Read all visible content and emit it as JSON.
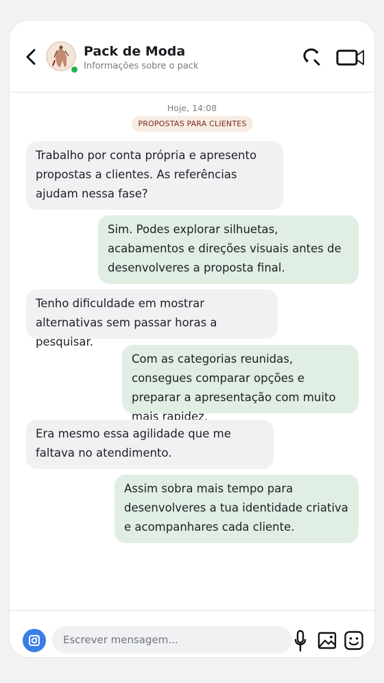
{
  "header": {
    "title": "Pack de Moda",
    "subtitle": "Informações sobre o pack",
    "icons": [
      "back-arrow-icon",
      "phone-icon",
      "video-camera-icon"
    ],
    "online_color": "#22b14c"
  },
  "thread": {
    "timestamp": "Hoje, 14:08",
    "tag": "PROPOSTAS PARA CLIENTES",
    "messages": [
      {
        "side": "in",
        "text": "Trabalho por conta própria e apresento propostas a clientes. As referências ajudam nessa fase?"
      },
      {
        "side": "out",
        "text": "Sim. Podes explorar silhuetas, acabamentos e direções visuais antes de desenvolveres a proposta final."
      },
      {
        "side": "in",
        "text": "Tenho dificuldade em mostrar alternativas sem passar horas a pesquisar."
      },
      {
        "side": "out",
        "text": "Com as categorias reunidas, consegues comparar opções e preparar a apresentação com muito mais rapidez."
      },
      {
        "side": "in",
        "text": "Era mesmo essa agilidade que me faltava no atendimento."
      },
      {
        "side": "out",
        "text": "Assim sobra mais tempo para desenvolveres a tua identidade criativa e acompanhares cada cliente."
      }
    ]
  },
  "composer": {
    "placeholder": "Escrever mensagem...",
    "value": "",
    "icons": [
      "camera-icon",
      "microphone-icon",
      "image-icon",
      "sticker-icon"
    ]
  },
  "colors": {
    "incoming_bubble": "#f0f1f3",
    "outgoing_bubble": "#e1eee4",
    "tag_bg": "#f8ece3",
    "tag_text": "#7a2a20",
    "camera_button": "#3a7ee8"
  }
}
